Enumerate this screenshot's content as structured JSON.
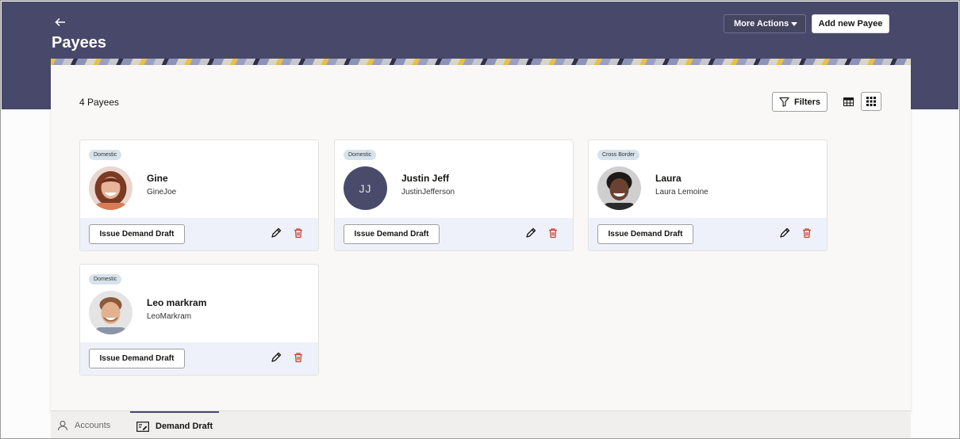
{
  "header": {
    "title": "Payees",
    "more_actions_label": "More Actions",
    "add_payee_label": "Add new Payee"
  },
  "toolbar": {
    "count_label": "4 Payees",
    "filters_label": "Filters"
  },
  "payees": [
    {
      "type": "Domestic",
      "name": "Gine",
      "nickname": "GineJoe",
      "initials": "",
      "action_label": "Issue Demand Draft"
    },
    {
      "type": "Domestic",
      "name": "Justin Jeff",
      "nickname": "JustinJefferson",
      "initials": "JJ",
      "action_label": "Issue Demand Draft"
    },
    {
      "type": "Cross Border",
      "name": "Laura",
      "nickname": "Laura Lemoine",
      "initials": "",
      "action_label": "Issue Demand Draft"
    },
    {
      "type": "Domestic",
      "name": "Leo markram",
      "nickname": "LeoMarkram",
      "initials": "",
      "action_label": "Issue Demand Draft"
    }
  ],
  "bottom_nav": {
    "accounts_label": "Accounts",
    "demand_draft_label": "Demand Draft"
  },
  "colors": {
    "header_bg": "#48496a",
    "badge_bg": "#d6e3ec",
    "delete_red": "#c74634",
    "footer_bg": "#eef1f9"
  }
}
